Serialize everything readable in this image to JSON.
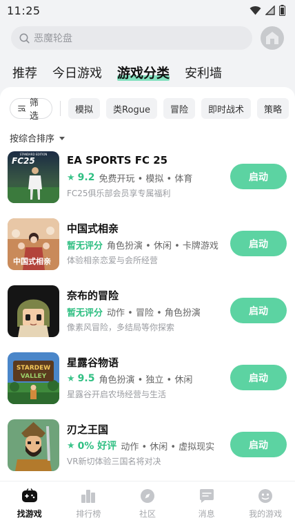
{
  "status_bar": {
    "time": "11:25"
  },
  "search": {
    "placeholder": "恶魔轮盘"
  },
  "top_tabs": [
    {
      "label": "推荐",
      "active": false
    },
    {
      "label": "今日游戏",
      "active": false
    },
    {
      "label": "游戏分类",
      "active": true
    },
    {
      "label": "安利墙",
      "active": false
    }
  ],
  "filter": {
    "button_label": "筛选",
    "chips": [
      "模拟",
      "类Rogue",
      "冒险",
      "即时战术",
      "策略"
    ]
  },
  "sort": {
    "label": "按综合排序"
  },
  "games": [
    {
      "title": "EA SPORTS FC 25",
      "rating": "9.2",
      "tags": "免费开玩 • 模拟 • 体育",
      "desc": "FC25俱乐部会员享专属福利",
      "button": "启动"
    },
    {
      "title": "中国式相亲",
      "rating_text": "暂无评分",
      "tags": "角色扮演 • 休闲 • 卡牌游戏",
      "desc": "体验相亲恋爱与会所经营",
      "button": "启动"
    },
    {
      "title": "奈布的冒险",
      "rating_text": "暂无评分",
      "tags": "动作 • 冒险 • 角色扮演",
      "desc": "像素风冒险，多结局等你探索",
      "button": "启动"
    },
    {
      "title": "星露谷物语",
      "rating": "9.5",
      "tags": "角色扮演 • 独立 • 休闲",
      "desc": "星露谷开启农场经营与生活",
      "button": "启动"
    },
    {
      "title": "刃之王国",
      "rating": "0% 好评",
      "tags": "动作 • 休闲 • 虚拟现实",
      "desc": "VR新切体验三国名将对决",
      "button": "启动"
    }
  ],
  "icon_text": {
    "fc25": "FC25",
    "fc25_edition": "STANDARD EDITION",
    "xiangqin": "中国式相亲",
    "stardew_line1": "STARDEW",
    "stardew_line2": "VALLEY"
  },
  "bottom_nav": [
    {
      "label": "找游戏",
      "icon": "gamepad-icon",
      "active": true
    },
    {
      "label": "排行榜",
      "icon": "ranking-icon",
      "active": false
    },
    {
      "label": "社区",
      "icon": "compass-icon",
      "active": false
    },
    {
      "label": "消息",
      "icon": "message-icon",
      "active": false
    },
    {
      "label": "我的游戏",
      "icon": "my-games-icon",
      "active": false
    }
  ],
  "colors": {
    "accent": "#5cd3a2",
    "rating": "#2fbf82",
    "background": "#f2f3f5"
  }
}
